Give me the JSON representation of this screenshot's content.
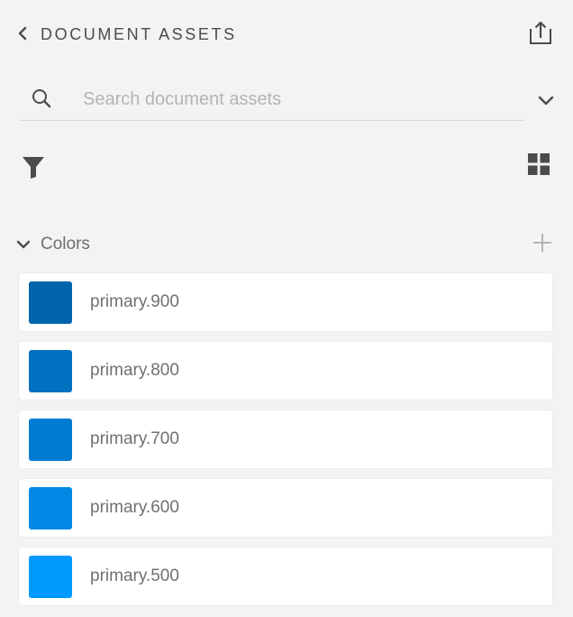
{
  "header": {
    "title": "DOCUMENT ASSETS",
    "back_icon": "chevron-left-icon",
    "export_icon": "share-export-icon"
  },
  "search": {
    "placeholder": "Search document assets",
    "value": "",
    "icon": "search-icon",
    "dropdown_icon": "chevron-down-icon"
  },
  "toolbar": {
    "filter_icon": "filter-icon",
    "view_icon": "grid-view-icon"
  },
  "section": {
    "label": "Colors",
    "expanded": true,
    "add_icon": "plus-icon",
    "items": [
      {
        "name": "primary.900",
        "color": "#0065ac"
      },
      {
        "name": "primary.800",
        "color": "#0070c1"
      },
      {
        "name": "primary.700",
        "color": "#007bd2"
      },
      {
        "name": "primary.600",
        "color": "#0088e4"
      },
      {
        "name": "primary.500",
        "color": "#0099fe"
      }
    ]
  }
}
